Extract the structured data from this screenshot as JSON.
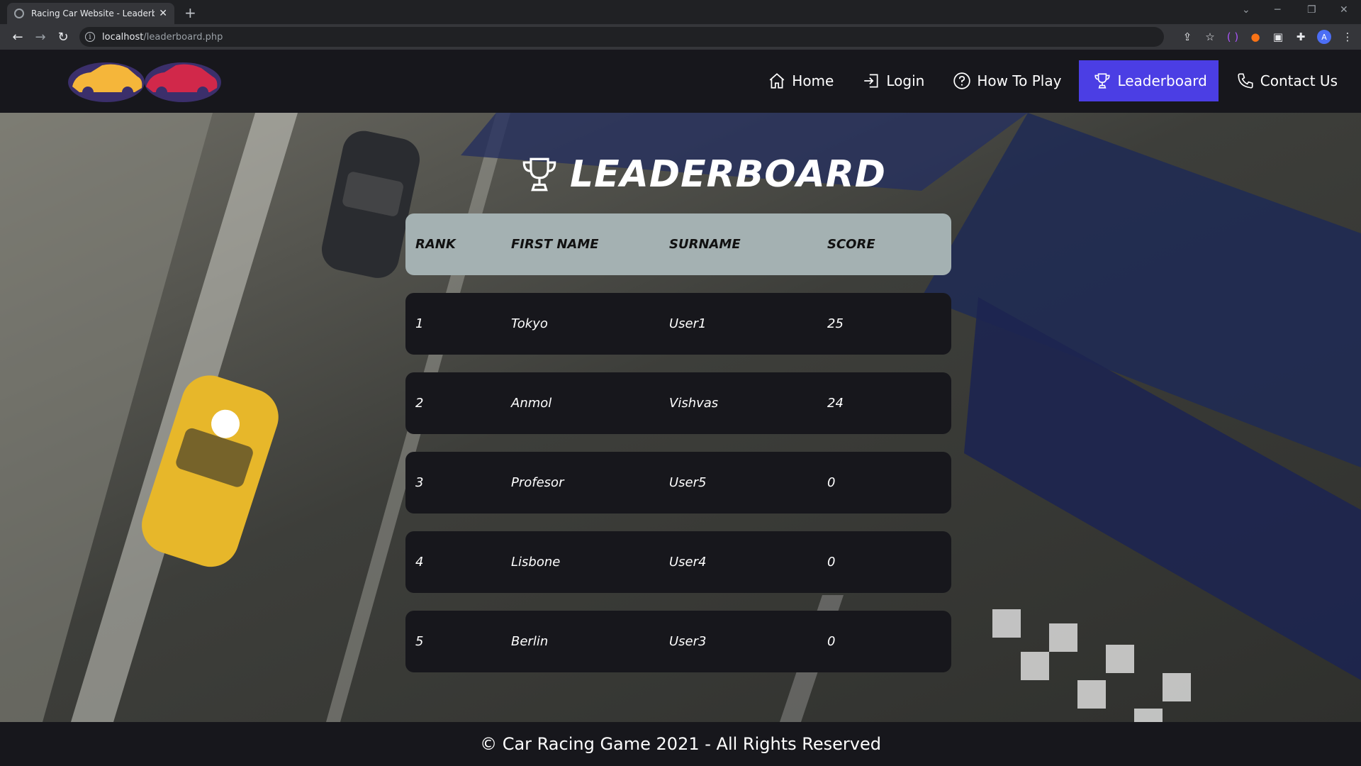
{
  "browser": {
    "tab_title": "Racing Car Website - Leaderboard",
    "url_host": "localhost",
    "url_path": "/leaderboard.php"
  },
  "nav": {
    "items": [
      {
        "label": "Home",
        "icon": "home-icon"
      },
      {
        "label": "Login",
        "icon": "login-icon"
      },
      {
        "label": "How To Play",
        "icon": "question-circle-icon"
      },
      {
        "label": "Leaderboard",
        "icon": "trophy-icon",
        "active": true
      },
      {
        "label": "Contact Us",
        "icon": "phone-icon"
      }
    ],
    "active_color": "#4b3ee4"
  },
  "leaderboard": {
    "title": "LEADERBOARD",
    "headers": {
      "rank": "RANK",
      "first_name": "FIRST NAME",
      "surname": "SURNAME",
      "score": "SCORE"
    },
    "rows": [
      {
        "rank": "1",
        "first_name": "Tokyo",
        "surname": "User1",
        "score": "25"
      },
      {
        "rank": "2",
        "first_name": "Anmol",
        "surname": "Vishvas",
        "score": "24"
      },
      {
        "rank": "3",
        "first_name": "Profesor",
        "surname": "User5",
        "score": "0"
      },
      {
        "rank": "4",
        "first_name": "Lisbone",
        "surname": "User4",
        "score": "0"
      },
      {
        "rank": "5",
        "first_name": "Berlin",
        "surname": "User3",
        "score": "0"
      }
    ]
  },
  "footer": {
    "text": "© Car Racing Game 2021 - All Rights Reserved"
  }
}
